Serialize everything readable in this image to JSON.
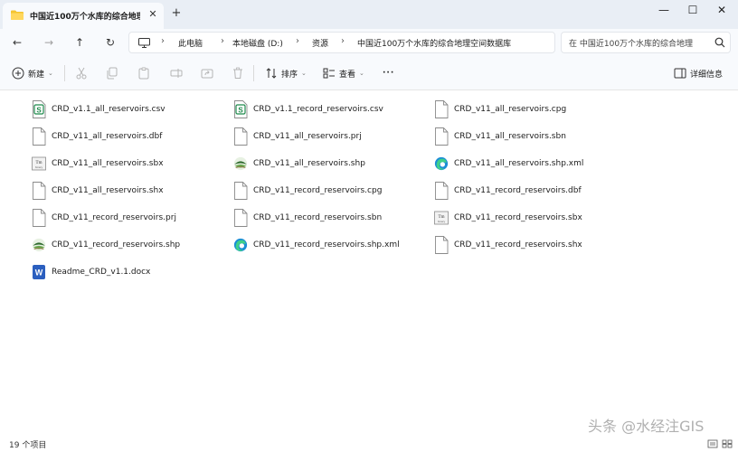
{
  "window": {
    "tab_title": "中国近100万个水库的综合地理",
    "close_tab": "✕",
    "new_tab": "+",
    "minimize": "—",
    "maximize": "☐",
    "close": "✕"
  },
  "nav": {
    "back": "←",
    "forward": "→",
    "up": "↑",
    "refresh": "↻"
  },
  "breadcrumb": [
    "此电脑",
    "本地磁盘 (D:)",
    "资源",
    "中国近100万个水库的综合地理空间数据库"
  ],
  "breadcrumb_separator": "›",
  "search": {
    "placeholder": "在 中国近100万个水库的综合地理"
  },
  "toolbar": {
    "new_label": "新建",
    "sort_label": "排序",
    "view_label": "查看",
    "more_label": "···",
    "details_label": "详细信息"
  },
  "files": [
    {
      "name": "CRD_v1.1_all_reservoirs.csv",
      "icon": "csv-icon"
    },
    {
      "name": "CRD_v1.1_record_reservoirs.csv",
      "icon": "csv-icon"
    },
    {
      "name": "CRD_v11_all_reservoirs.cpg",
      "icon": "blank-file-icon"
    },
    {
      "name": "CRD_v11_all_reservoirs.dbf",
      "icon": "blank-file-icon"
    },
    {
      "name": "CRD_v11_all_reservoirs.prj",
      "icon": "blank-file-icon"
    },
    {
      "name": "CRD_v11_all_reservoirs.sbn",
      "icon": "blank-file-icon"
    },
    {
      "name": "CRD_v11_all_reservoirs.sbx",
      "icon": "sbx-icon"
    },
    {
      "name": "CRD_v11_all_reservoirs.shp",
      "icon": "shp-icon"
    },
    {
      "name": "CRD_v11_all_reservoirs.shp.xml",
      "icon": "edge-icon"
    },
    {
      "name": "CRD_v11_all_reservoirs.shx",
      "icon": "blank-file-icon"
    },
    {
      "name": "CRD_v11_record_reservoirs.cpg",
      "icon": "blank-file-icon"
    },
    {
      "name": "CRD_v11_record_reservoirs.dbf",
      "icon": "blank-file-icon"
    },
    {
      "name": "CRD_v11_record_reservoirs.prj",
      "icon": "blank-file-icon"
    },
    {
      "name": "CRD_v11_record_reservoirs.sbn",
      "icon": "blank-file-icon"
    },
    {
      "name": "CRD_v11_record_reservoirs.sbx",
      "icon": "sbx-icon"
    },
    {
      "name": "CRD_v11_record_reservoirs.shp",
      "icon": "shp-icon"
    },
    {
      "name": "CRD_v11_record_reservoirs.shp.xml",
      "icon": "edge-icon"
    },
    {
      "name": "CRD_v11_record_reservoirs.shx",
      "icon": "blank-file-icon"
    },
    {
      "name": "Readme_CRD_v1.1.docx",
      "icon": "word-icon"
    }
  ],
  "status": {
    "item_count": "19 个项目"
  },
  "watermark": "头条 @水经注GIS",
  "colors": {
    "titlebar_bg": "#e9eef5",
    "toolbar_bg": "#f8fafd",
    "accent": "#0067c0",
    "csv_green": "#1f8a4c",
    "word_blue": "#2b5fbf"
  }
}
